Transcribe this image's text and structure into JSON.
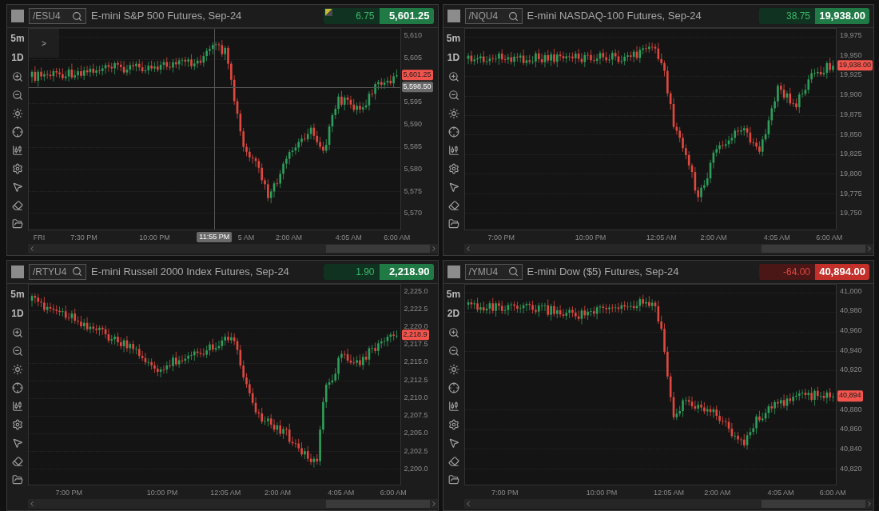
{
  "panels": [
    {
      "symbol": "/ESU4",
      "title": "E-mini S&P 500 Futures, Sep-24",
      "alert_flag": true,
      "negative": false,
      "change": "6.75",
      "price": "5,601.25",
      "interval": "5m",
      "range": "1D",
      "expand_label": ">",
      "y_ticks": [
        "5,610",
        "5,605",
        "5,595",
        "5,590",
        "5,585",
        "5,580",
        "5,575",
        "5,570"
      ],
      "price_label": "5,601.25",
      "x_ticks": [
        "FRI",
        "7:30 PM",
        "10:00 PM",
        "5 AM",
        "2:00 AM",
        "4:05 AM",
        "6:00 AM"
      ],
      "crosshair": {
        "price_label": "5,598.50",
        "time_label": "11:55 PM"
      }
    },
    {
      "symbol": "/NQU4",
      "title": "E-mini NASDAQ-100 Futures, Sep-24",
      "negative": false,
      "change": "38.75",
      "price": "19,938.00",
      "interval": "5m",
      "range": "1D",
      "y_ticks": [
        "19,975",
        "19,950",
        "19,925",
        "19,900",
        "19,875",
        "19,850",
        "19,825",
        "19,800",
        "19,775",
        "19,750"
      ],
      "price_label": "19,938.00",
      "x_ticks": [
        "7:00 PM",
        "10:00 PM",
        "12:05 AM",
        "2:00 AM",
        "4:05 AM",
        "6:00 AM"
      ]
    },
    {
      "symbol": "/RTYU4",
      "title": "E-mini Russell 2000 Index Futures, Sep-24",
      "negative": false,
      "change": "1.90",
      "price": "2,218.90",
      "interval": "5m",
      "range": "1D",
      "y_ticks": [
        "2,225.0",
        "2,222.5",
        "2,220.0",
        "2,217.5",
        "2,215.0",
        "2,212.5",
        "2,210.0",
        "2,207.5",
        "2,205.0",
        "2,202.5",
        "2,200.0"
      ],
      "price_label": "2,218.9",
      "x_ticks": [
        "7:00 PM",
        "10:00 PM",
        "12:05 AM",
        "2:00 AM",
        "4:05 AM",
        "6:00 AM"
      ]
    },
    {
      "symbol": "/YMU4",
      "title": "E-mini Dow ($5) Futures, Sep-24",
      "negative": true,
      "change": "-64.00",
      "price": "40,894.00",
      "interval": "5m",
      "range": "2D",
      "y_ticks": [
        "41,000",
        "40,980",
        "40,960",
        "40,940",
        "40,920",
        "40,880",
        "40,860",
        "40,840",
        "40,820"
      ],
      "price_label": "40,894",
      "x_ticks": [
        "7:00 PM",
        "10:00 PM",
        "12:05 AM",
        "2:00 AM",
        "4:05 AM",
        "6:00 AM"
      ]
    }
  ]
}
